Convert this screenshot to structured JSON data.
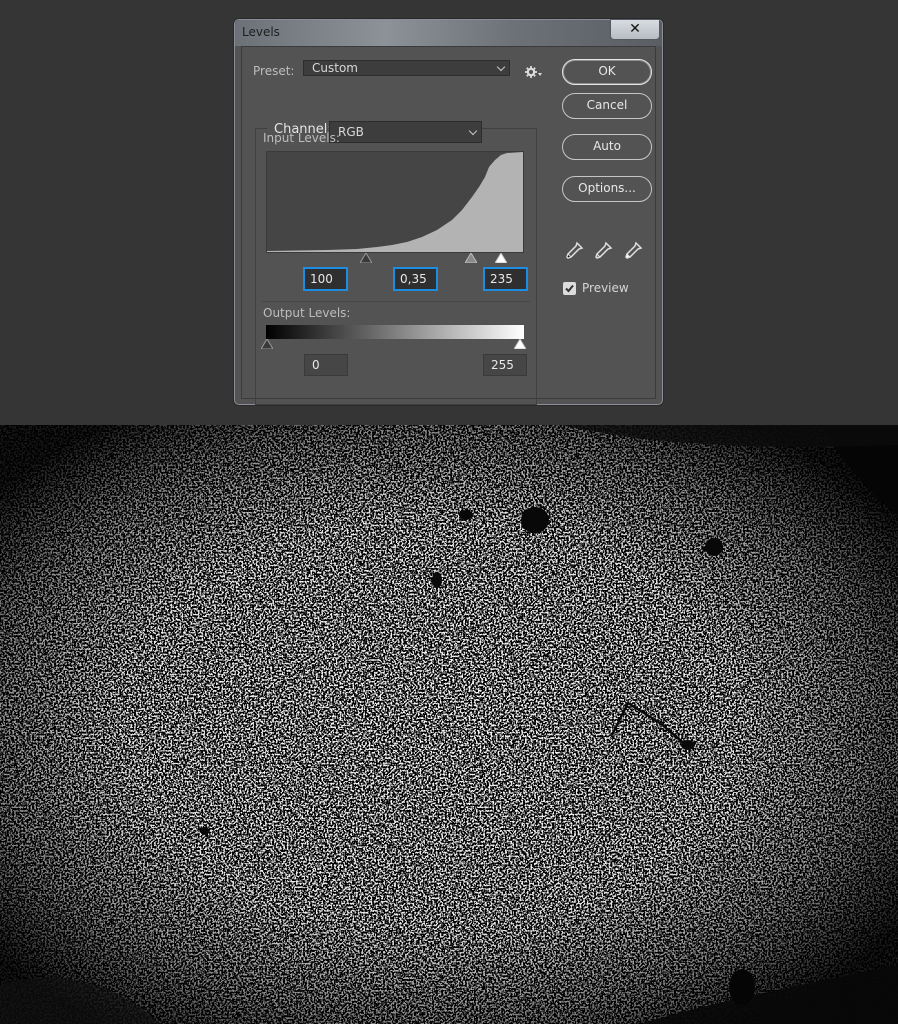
{
  "dialog": {
    "title": "Levels",
    "close_glyph": "✕",
    "preset": {
      "label": "Preset:",
      "value": "Custom",
      "options_icon": "gear-icon"
    },
    "channel": {
      "label": "Channel:",
      "value": "RGB"
    },
    "input_levels": {
      "label": "Input Levels:",
      "black": "100",
      "gamma": "0,35",
      "white": "235"
    },
    "output_levels": {
      "label": "Output Levels:",
      "black": "0",
      "white": "255"
    },
    "buttons": {
      "ok": "OK",
      "cancel": "Cancel",
      "auto": "Auto",
      "options": "Options..."
    },
    "eyedroppers": [
      "black-point-eyedropper-icon",
      "gray-point-eyedropper-icon",
      "white-point-eyedropper-icon"
    ],
    "preview": {
      "label": "Preview",
      "checked": true
    }
  },
  "colors": {
    "focus_border": "#1c8de0",
    "dialog_bg": "#535353",
    "workspace_bg": "#353535"
  }
}
